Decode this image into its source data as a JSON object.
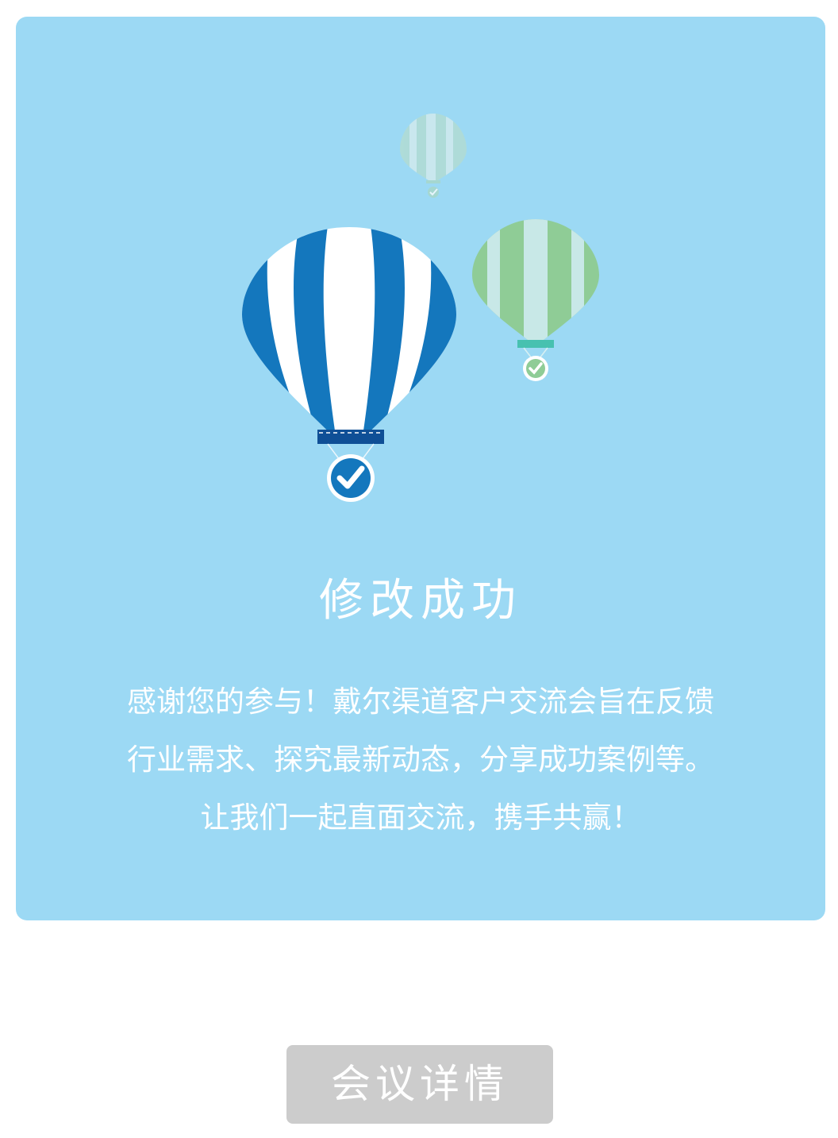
{
  "success_card": {
    "title": "修改成功",
    "message_lines": [
      "感谢您的参与！戴尔渠道客户交流会旨在反馈",
      "行业需求、探究最新动态，分享成功案例等。",
      "让我们一起直面交流，携手共赢！"
    ]
  },
  "actions": {
    "details_label": "会议详情"
  },
  "colors": {
    "card_background": "#9cd9f4",
    "balloon_blue": "#1477bd",
    "balloon_green": "#8fcc96",
    "button_background": "#cccccc"
  },
  "icons": [
    "hot-air-balloon-icon",
    "check-circle-icon"
  ]
}
